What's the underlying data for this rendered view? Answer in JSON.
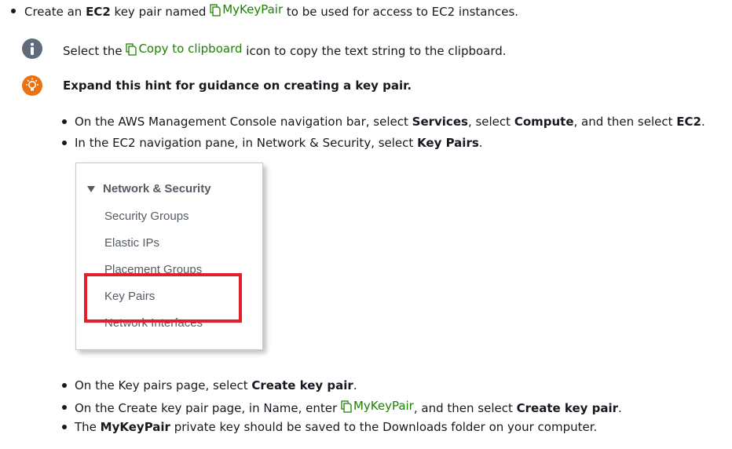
{
  "task": {
    "prefix": "Create an ",
    "ec2": "EC2",
    "mid": " key pair named ",
    "keypair_name": "MyKeyPair",
    "suffix": " to be used for access to EC2 instances."
  },
  "info": {
    "prefix": "Select the ",
    "link": "Copy to clipboard",
    "suffix": " icon to copy the text string to the clipboard."
  },
  "hint": {
    "title": "Expand this hint for guidance on creating a key pair."
  },
  "steps": {
    "s1": {
      "a": "On the AWS Management Console navigation bar, select ",
      "b1": "Services",
      "c": ", select ",
      "b2": "Compute",
      "d": ", and then select ",
      "b3": "EC2",
      "e": "."
    },
    "s2": {
      "a": "In the EC2 navigation pane, in Network & Security, select ",
      "b1": "Key Pairs",
      "e": "."
    },
    "s3": {
      "a": "On the Key pairs page, select ",
      "b1": "Create key pair",
      "e": "."
    },
    "s4": {
      "a": "On the Create key pair page, in Name, enter ",
      "link": "MyKeyPair",
      "c": ", and then select ",
      "b1": "Create key pair",
      "e": "."
    },
    "s5": {
      "a": "The ",
      "b1": "MyKeyPair",
      "c": " private key should be saved to the Downloads folder on your computer."
    }
  },
  "panel": {
    "header": "Network & Security",
    "items": [
      "Security Groups",
      "Elastic IPs",
      "Placement Groups",
      "Key Pairs",
      "Network Interfaces"
    ]
  },
  "colors": {
    "link_green": "#1d8102",
    "info_gray": "#5f6b7a",
    "hint_orange": "#ec7211",
    "highlight_red": "#e0202b"
  },
  "icons": {
    "copy": "copy-icon",
    "info": "info-icon",
    "hint": "lightbulb-icon"
  }
}
